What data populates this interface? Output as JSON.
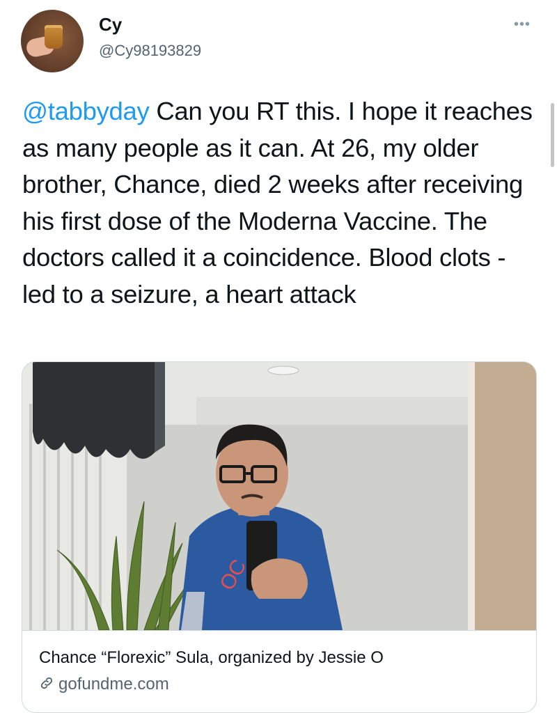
{
  "user": {
    "name": "Cy",
    "handle": "@Cy98193829"
  },
  "more_label": "•••",
  "tweet": {
    "mention": "@tabbyday",
    "body": " Can you RT this. I hope it reaches as many people as it can. At 26, my older brother, Chance, died 2 weeks after receiving his first dose of the Moderna Vaccine. The doctors called it a coincidence. Blood clots -led to a seizure, a heart attack"
  },
  "card": {
    "title": "Chance “Florexic” Sula, organized by Jessie O",
    "domain": "gofundme.com"
  },
  "colors": {
    "mention": "#1d9bf0",
    "shirt": "#2c5aa0"
  }
}
